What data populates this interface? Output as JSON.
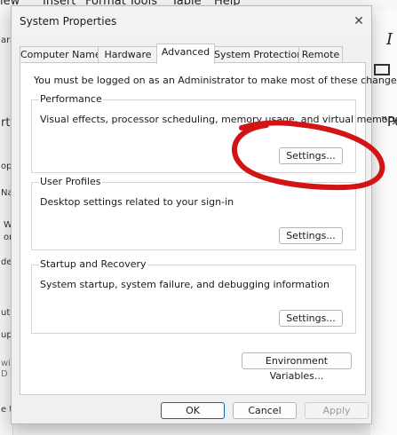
{
  "background_app": {
    "menu": [
      "iew",
      "Insert",
      "Format",
      "Tools",
      "Table",
      "Help"
    ],
    "left_snippets": [
      "ara",
      "rti",
      "ope",
      "Nar",
      "W",
      "or",
      "de",
      "ute",
      "up:",
      "wi:",
      "D",
      "e t"
    ],
    "right_snippets": [
      "I",
      "\"Po"
    ]
  },
  "dialog": {
    "title": "System Properties",
    "close_glyph": "✕",
    "tabs": [
      "Computer Name",
      "Hardware",
      "Advanced",
      "System Protection",
      "Remote"
    ],
    "active_tab": "Advanced",
    "admin_note": "You must be logged on as an Administrator to make most of these changes.",
    "performance": {
      "title": "Performance",
      "description": "Visual effects, processor scheduling, memory usage, and virtual memory",
      "button": "Settings..."
    },
    "user_profiles": {
      "title": "User Profiles",
      "description": "Desktop settings related to your sign-in",
      "button": "Settings..."
    },
    "startup_recovery": {
      "title": "Startup and Recovery",
      "description": "System startup, system failure, and debugging information",
      "button": "Settings..."
    },
    "env_button": "Environment Variables...",
    "ok": "OK",
    "cancel": "Cancel",
    "apply": "Apply"
  },
  "colors": {
    "annotation": "#d11414",
    "focus": "#0067c0"
  }
}
